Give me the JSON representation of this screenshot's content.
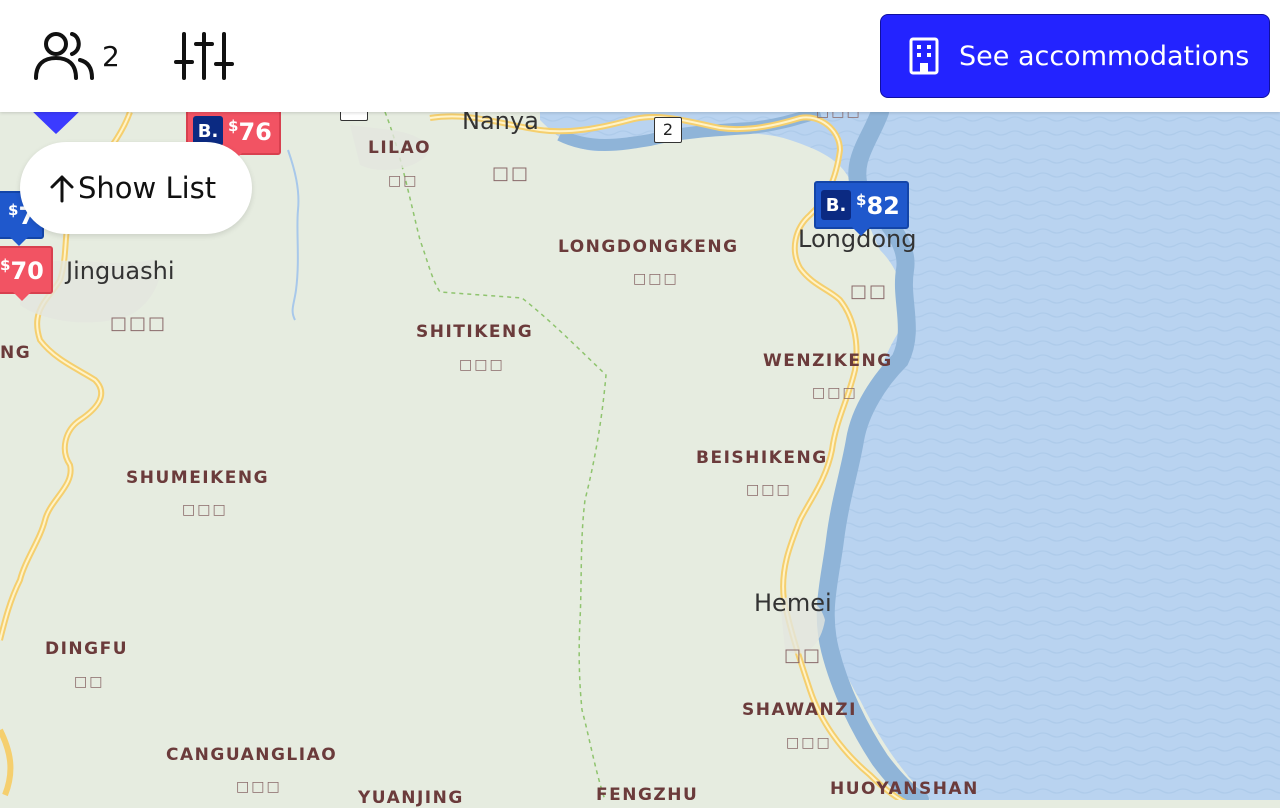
{
  "topbar": {
    "guest_count": "2",
    "accommodations_button": "See accommodations",
    "icons": {
      "guests": "users-icon",
      "filters": "sliders-icon",
      "building": "building-icon"
    }
  },
  "show_list_button": "Show List",
  "map": {
    "districts": {
      "lilao": "LILAO",
      "longdongkeng": "LONGDONGKENG",
      "shitikeng": "SHITIKENG",
      "wenzikeng": "WENZIKENG",
      "beishikeng": "BEISHIKENG",
      "shumeikeng": "SHUMEIKENG",
      "dingfu": "DINGFU",
      "canguangliao": "CANGUANGLIAO",
      "shawanzi": "SHAWANZI",
      "huoyanshan": "HUOYANSHAN",
      "yuanjing": "YUANJING",
      "fengzhu": "FENGZHU",
      "ng_partial": "NG"
    },
    "towns": {
      "nanya": "Nanya",
      "jinguashi": "Jinguashi",
      "longdong": "Longdong",
      "hemei": "Hemei"
    },
    "cjk": {
      "lilao": "□□",
      "nanya": "□□",
      "longdongkeng": "□□□",
      "shitikeng": "□□□",
      "wenzikeng": "□□□",
      "beishikeng": "□□□",
      "jinguashi": "□□□",
      "longdong": "□□",
      "shumeikeng": "□□□",
      "dingfu": "□□",
      "hemei": "□□",
      "shawanzi": "□□□",
      "canguangliao": "□□□",
      "top_right": "□□□"
    },
    "road_shield": "2",
    "price_markers": [
      {
        "brand": "B.",
        "price": "82",
        "color": "#1f58cc"
      },
      {
        "brand": "B.",
        "price": "76",
        "color": "#f25363"
      },
      {
        "brand": "",
        "price": "70",
        "color": "#1f58cc"
      },
      {
        "brand": "",
        "price": "7",
        "color": "#1f58cc"
      }
    ],
    "currency": "$",
    "pin_color": "#3b3bff",
    "water_color": "#b9d3f0",
    "land_color": "#e6ece0"
  }
}
